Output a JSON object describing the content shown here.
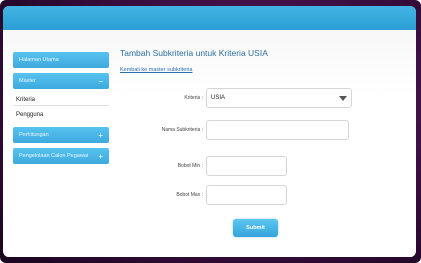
{
  "sidebar": {
    "items": [
      {
        "label": "Halaman Utama",
        "sign": ""
      },
      {
        "label": "Master",
        "sign": "−"
      },
      {
        "label": "Perhitungan",
        "sign": "+"
      },
      {
        "label": "Pengelolaan Calon Pegawai",
        "sign": "+"
      }
    ],
    "master_sub": [
      "Kriteria",
      "Pengguna"
    ]
  },
  "main": {
    "title": "Tambah Subkriteria untuk Kriteria USIA",
    "back_link": "Kembali ke master subkriteria",
    "form": {
      "kriteria_label": "Kriteria :",
      "kriteria_value": "USIA",
      "nama_label": "Nama Subkriteria :",
      "nama_value": "",
      "bobot_min_label": "Bobot Min :",
      "bobot_min_value": "",
      "bobot_max_label": "Bobot Max :",
      "bobot_max_value": "",
      "submit_label": "Submit"
    }
  }
}
